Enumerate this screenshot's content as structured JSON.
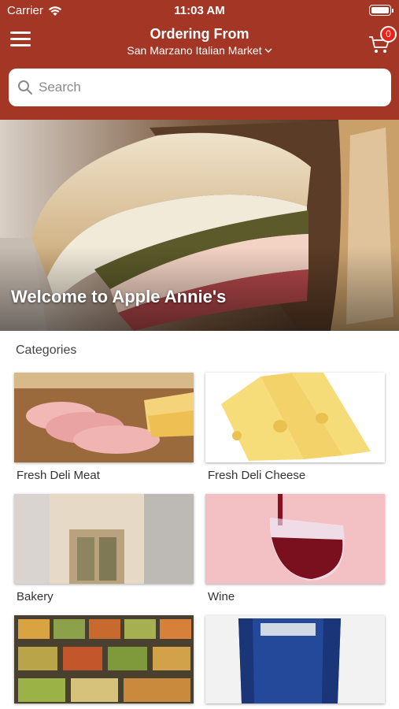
{
  "status_bar": {
    "carrier": "Carrier",
    "time": "11:03 AM"
  },
  "header": {
    "title": "Ordering From",
    "store_name": "San Marzano Italian Market",
    "cart_count": "0"
  },
  "search": {
    "placeholder": "Search"
  },
  "hero": {
    "title": "Welcome to Apple Annie's"
  },
  "categories": {
    "heading": "Categories",
    "items": [
      {
        "label": "Fresh Deli Meat"
      },
      {
        "label": "Fresh Deli Cheese"
      },
      {
        "label": "Bakery"
      },
      {
        "label": "Wine"
      },
      {
        "label": ""
      },
      {
        "label": ""
      }
    ]
  },
  "colors": {
    "brand": "#a33625",
    "badge": "#e8251d"
  }
}
